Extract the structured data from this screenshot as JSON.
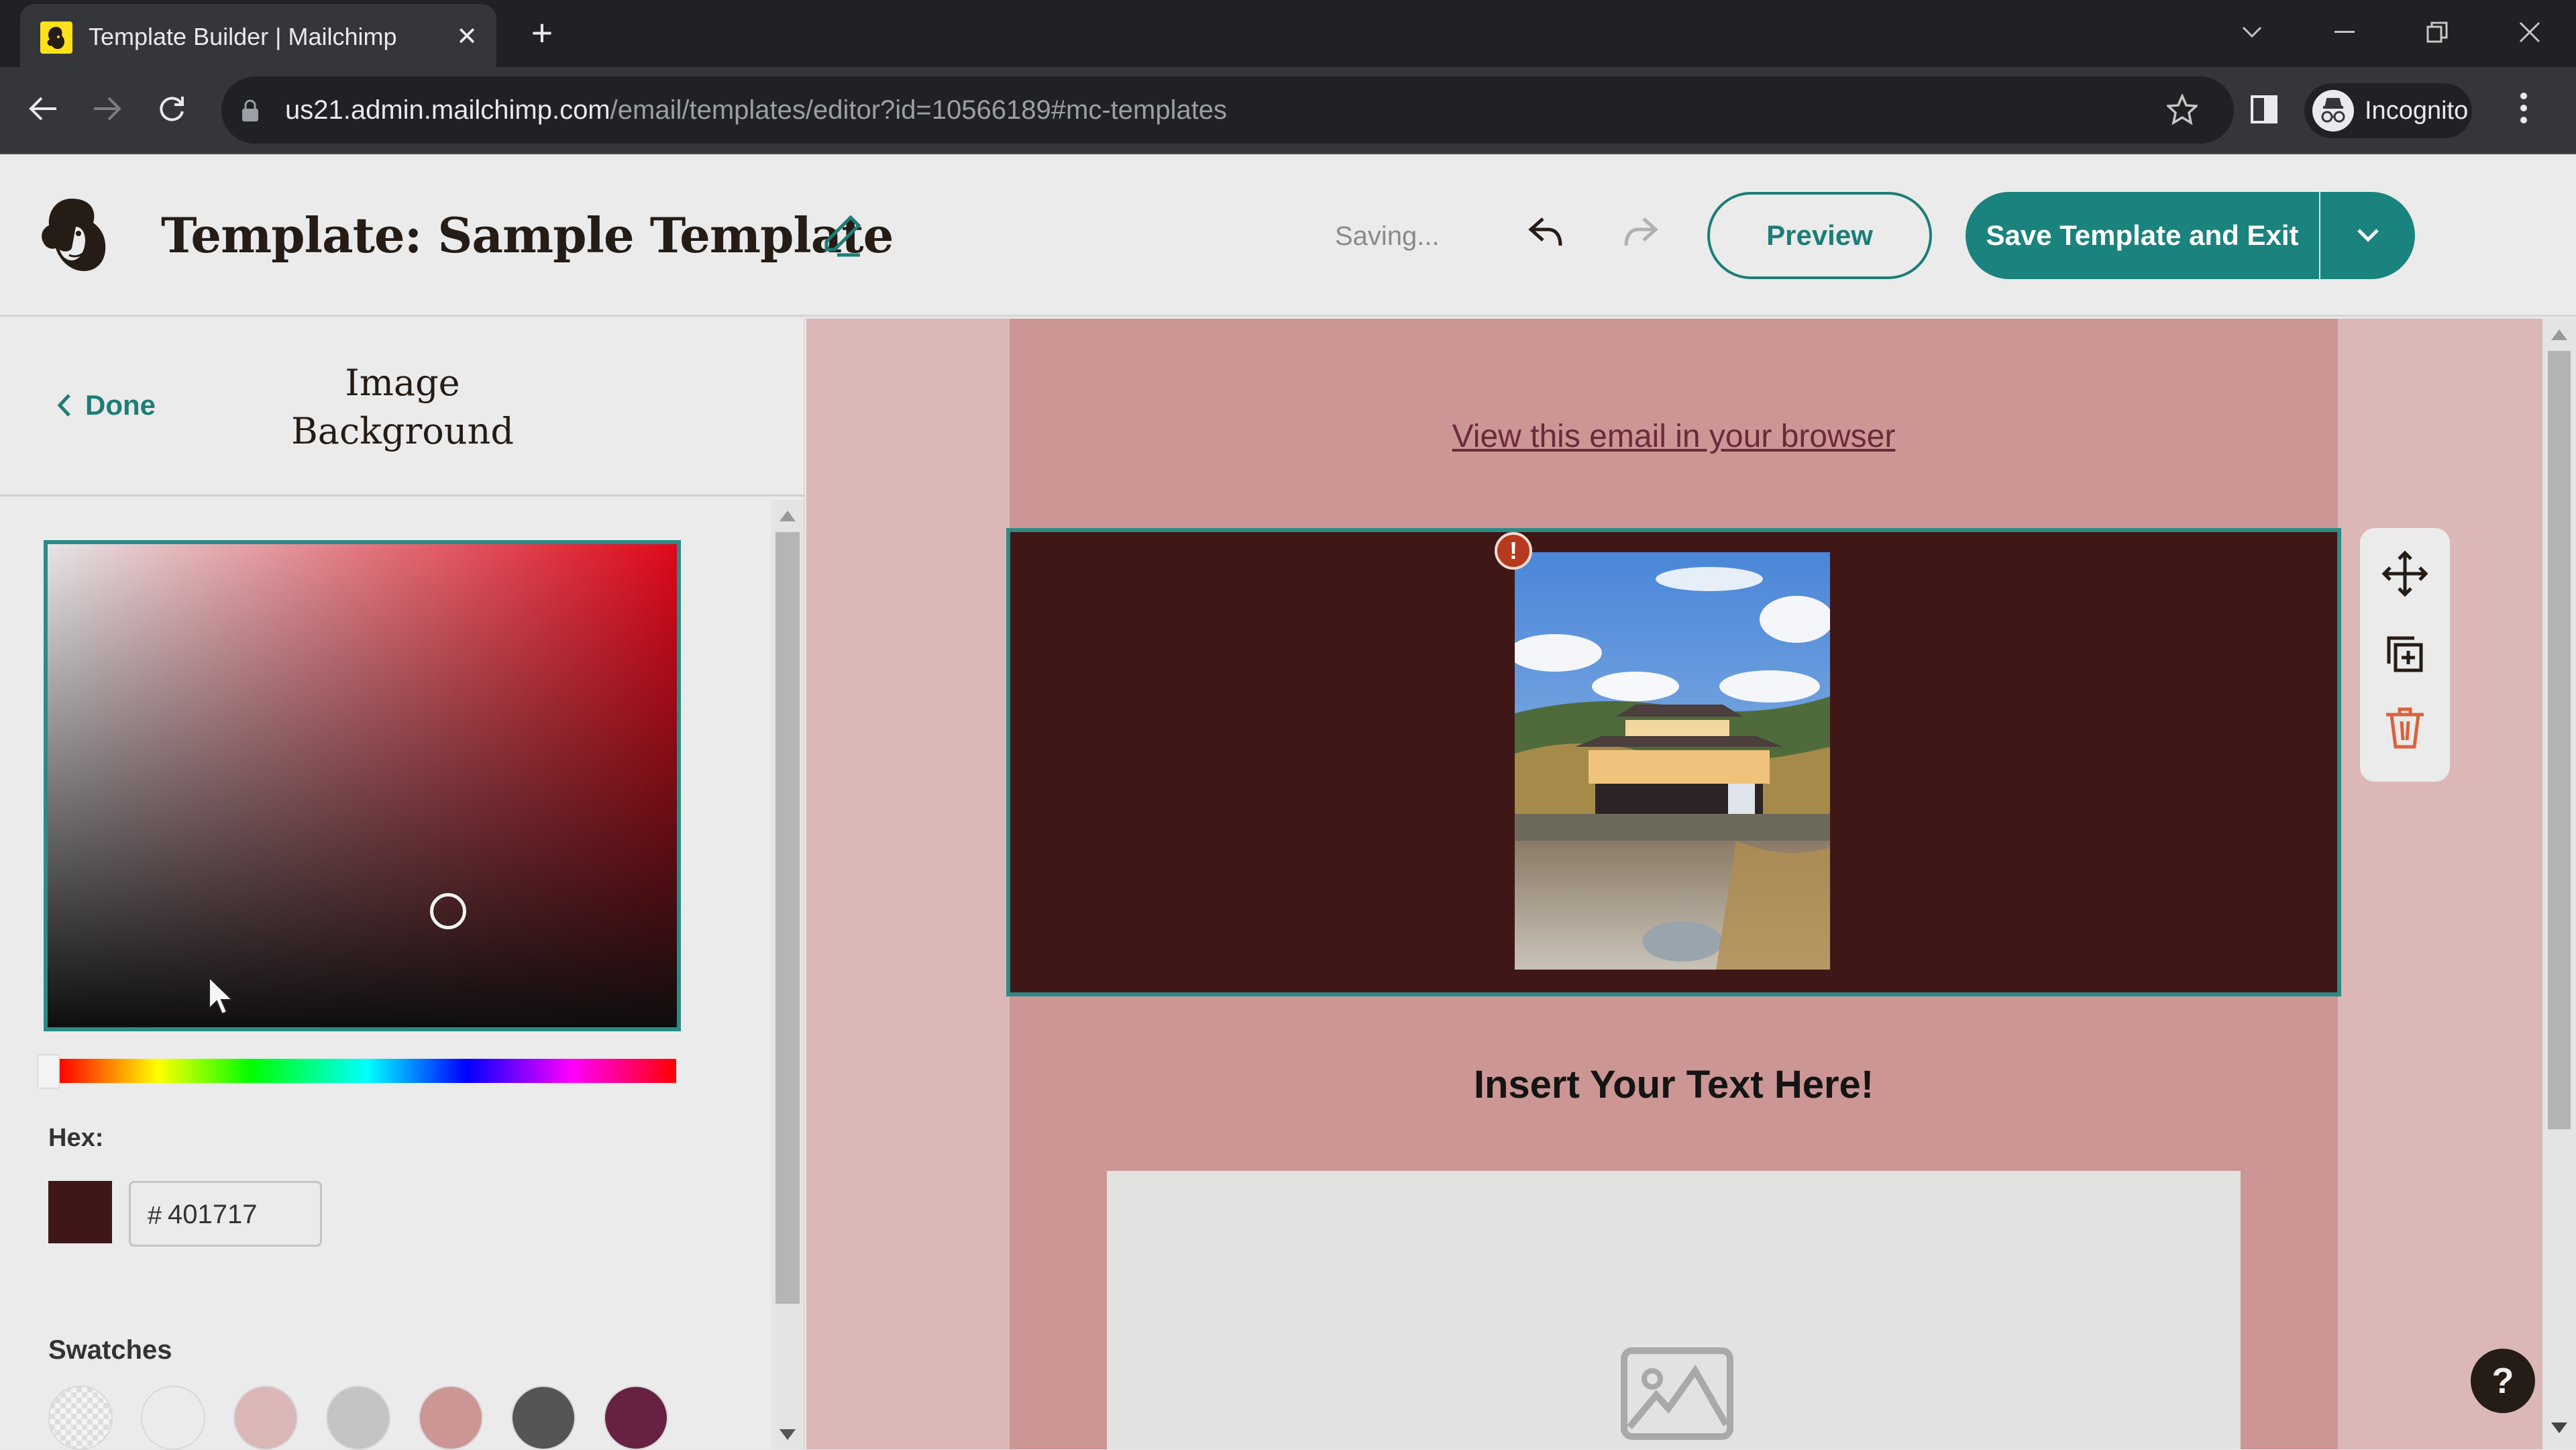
{
  "browser": {
    "tab_title": "Template Builder | Mailchimp",
    "url_host": "us21.admin.mailchimp.com",
    "url_path": "/email/templates/editor?id=10566189#mc-templates",
    "profile_label": "Incognito"
  },
  "header": {
    "title": "Template: Sample Template",
    "status": "Saving...",
    "preview_label": "Preview",
    "save_label": "Save Template and Exit"
  },
  "sidebar": {
    "done_label": "Done",
    "panel_title_line1": "Image",
    "panel_title_line2": "Background",
    "hex_label": "Hex:",
    "hex_prefix": "#",
    "hex_value": "401717",
    "selected_color": "#401717",
    "hue_position": 0,
    "swatches_label": "Swatches",
    "swatches": [
      {
        "name": "transparent",
        "color": "transparent"
      },
      {
        "name": "white",
        "color": "#ebebeb"
      },
      {
        "name": "light-pink",
        "color": "#dcb7b7"
      },
      {
        "name": "light-gray",
        "color": "#c4c4c4"
      },
      {
        "name": "dusty-rose",
        "color": "#cb9694"
      },
      {
        "name": "dark-gray",
        "color": "#555555"
      },
      {
        "name": "plum",
        "color": "#672142"
      }
    ]
  },
  "canvas": {
    "view_in_browser_link": "View this email in your browser",
    "warning_badge": "!",
    "heading": "Insert Your Text Here!",
    "colors": {
      "outer_background": "#dcb7b7",
      "email_background": "#cb9694",
      "image_block_background": "#401717",
      "selection_outline": "#2b8b86",
      "placeholder_background": "#e2e2e0"
    }
  },
  "block_toolbar": {
    "move_label": "Move block",
    "duplicate_label": "Duplicate block",
    "delete_label": "Delete block"
  },
  "help_label": "?",
  "theme": {
    "accent": "#1b837e",
    "delete_color": "#d9623d"
  }
}
